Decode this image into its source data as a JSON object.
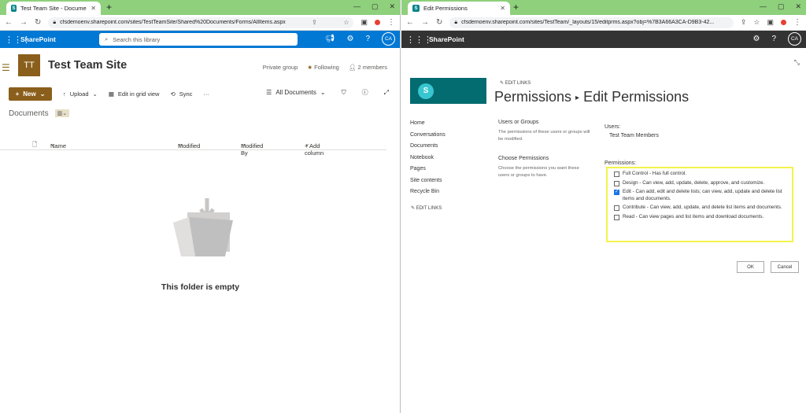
{
  "left": {
    "tab": {
      "title": "Test Team Site - Documents - All"
    },
    "address": {
      "url": "cfsdemoenv.sharepoint.com/sites/TestTeamSite/Shared%20Documents/Forms/AllItems.aspx"
    },
    "suite": {
      "app": "SharePoint",
      "search_placeholder": "Search this library",
      "avatar": "CA"
    },
    "site": {
      "logo": "TT",
      "name": "Test Team Site",
      "privacy": "Private group",
      "following": "Following",
      "members": "2 members"
    },
    "commands": {
      "new": "New",
      "upload": "Upload",
      "grid": "Edit in grid view",
      "sync": "Sync",
      "more": "···",
      "view": "All Documents"
    },
    "library": {
      "title": "Documents"
    },
    "columns": {
      "name": "Name",
      "modified": "Modified",
      "modified_by": "Modified By",
      "add": "+ Add column"
    },
    "empty": {
      "text": "This folder is empty"
    }
  },
  "right": {
    "tab": {
      "title": "Edit Permissions"
    },
    "address": {
      "url": "cfsdemoenv.sharepoint.com/sites/TestTeam/_layouts/15/editprms.aspx?obj=%7B3A66A3CA-D9B3-42..."
    },
    "suite": {
      "app": "SharePoint",
      "avatar": "CA"
    },
    "edit_links": "EDIT LINKS",
    "title": {
      "main": "Permissions",
      "sub": "Edit Permissions"
    },
    "nav": [
      "Home",
      "Conversations",
      "Documents",
      "Notebook",
      "Pages",
      "Site contents",
      "Recycle Bin"
    ],
    "sections": {
      "users_or_groups": "Users or Groups",
      "users_desc": "The permissions of these users or groups will be modified.",
      "choose": "Choose Permissions",
      "choose_desc": "Choose the permissions you want these users or groups to have."
    },
    "users_label": "Users:",
    "users_value": "Test Team Members",
    "permissions_label": "Permissions:",
    "permissions": [
      {
        "label": "Full Control - Has full control.",
        "checked": false
      },
      {
        "label": "Design - Can view, add, update, delete, approve, and customize.",
        "checked": false
      },
      {
        "label": "Edit - Can add, edit and delete lists; can view, add, update and delete list items and documents.",
        "checked": true
      },
      {
        "label": "Contribute - Can view, add, update, and delete list items and documents.",
        "checked": false
      },
      {
        "label": "Read - Can view pages and list items and download documents.",
        "checked": false
      }
    ],
    "buttons": {
      "ok": "OK",
      "cancel": "Cancel"
    }
  },
  "colors": {
    "sp_blue": "#0078d4",
    "site_gold": "#8a5f1b",
    "chrome_green": "#8ed07b",
    "highlight": "#f3f34b",
    "dark_suite": "#333333"
  }
}
